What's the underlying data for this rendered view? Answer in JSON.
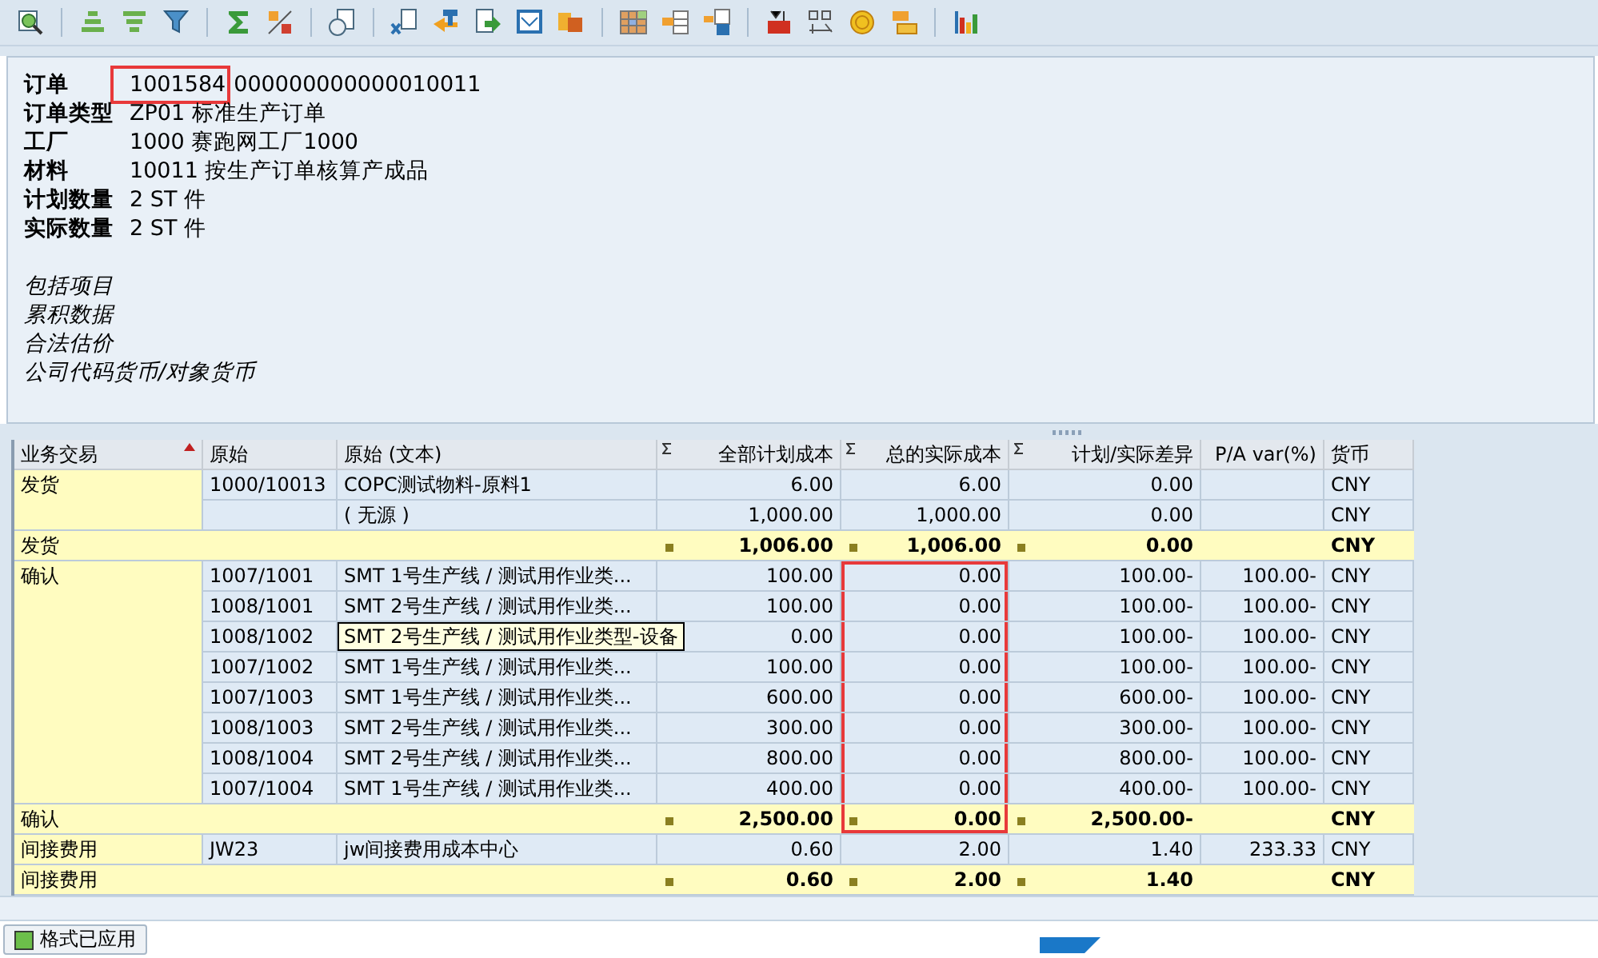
{
  "header": {
    "fields": [
      {
        "label": "订单",
        "highlight": "1001584",
        "value": "000000000000010011"
      },
      {
        "label": "订单类型",
        "value": "ZP01 标准生产订单"
      },
      {
        "label": "工厂",
        "value": "1000 赛跑网工厂1000"
      },
      {
        "label": "材料",
        "value": "10011 按生产订单核算产成品"
      },
      {
        "label": "计划数量",
        "value": "2 ST 件"
      },
      {
        "label": "实际数量",
        "value": "2 ST 件"
      }
    ],
    "notes": [
      "包括项目",
      "累积数据",
      "合法估价",
      "公司代码货币/对象货币"
    ]
  },
  "table": {
    "columns": [
      {
        "label": "业务交易",
        "sorted": true,
        "sum": false
      },
      {
        "label": "原始",
        "sorted": false,
        "sum": false
      },
      {
        "label": "原始 (文本)",
        "sorted": false,
        "sum": false
      },
      {
        "label": "全部计划成本",
        "sorted": false,
        "sum": true
      },
      {
        "label": "总的实际成本",
        "sorted": false,
        "sum": true
      },
      {
        "label": "计划/实际差异",
        "sorted": false,
        "sum": true
      },
      {
        "label": "P/A var(%)",
        "sorted": false,
        "sum": false
      },
      {
        "label": "货币",
        "sorted": false,
        "sum": false
      }
    ],
    "groups": [
      {
        "label": "发货",
        "items": [
          {
            "origin": "1000/10013",
            "text": "COPC测试物料-原料1",
            "plan": "6.00",
            "actual": "6.00",
            "diff": "0.00",
            "currency": "CNY",
            "marked": false
          },
          {
            "text": "( 无源 )",
            "plan": "1,000.00",
            "actual": "1,000.00",
            "diff": "0.00",
            "currency": "CNY",
            "marked": false
          }
        ],
        "total": {
          "label": "发货",
          "plan": "1,006.00",
          "actual": "1,006.00",
          "diff": "0.00",
          "currency": "CNY",
          "marked": false
        }
      },
      {
        "label": "确认",
        "items": [
          {
            "origin": "1007/1001",
            "text": "SMT 1号生产线 / 测试用作业类...",
            "plan": "100.00",
            "actual": "0.00",
            "diff": "100.00-",
            "pct": "100.00-",
            "currency": "CNY",
            "marked": true
          },
          {
            "origin": "1008/1001",
            "text": "SMT 2号生产线 / 测试用作业类...",
            "plan": "100.00",
            "actual": "0.00",
            "diff": "100.00-",
            "pct": "100.00-",
            "currency": "CNY",
            "marked": true
          },
          {
            "origin": "1008/1002",
            "tooltip": "SMT 2号生产线 / 测试用作业类型-设备",
            "plan": "0.00",
            "actual": "0.00",
            "diff": "100.00-",
            "pct": "100.00-",
            "currency": "CNY",
            "marked": true
          },
          {
            "origin": "1007/1002",
            "text": "SMT 1号生产线 / 测试用作业类...",
            "plan": "100.00",
            "actual": "0.00",
            "diff": "100.00-",
            "pct": "100.00-",
            "currency": "CNY",
            "marked": true
          },
          {
            "origin": "1007/1003",
            "text": "SMT 1号生产线 / 测试用作业类...",
            "plan": "600.00",
            "actual": "0.00",
            "diff": "600.00-",
            "pct": "100.00-",
            "currency": "CNY",
            "marked": true
          },
          {
            "origin": "1008/1003",
            "text": "SMT 2号生产线 / 测试用作业类...",
            "plan": "300.00",
            "actual": "0.00",
            "diff": "300.00-",
            "pct": "100.00-",
            "currency": "CNY",
            "marked": true
          },
          {
            "origin": "1008/1004",
            "text": "SMT 2号生产线 / 测试用作业类...",
            "plan": "800.00",
            "actual": "0.00",
            "diff": "800.00-",
            "pct": "100.00-",
            "currency": "CNY",
            "marked": true
          },
          {
            "origin": "1007/1004",
            "text": "SMT 1号生产线 / 测试用作业类...",
            "plan": "400.00",
            "actual": "0.00",
            "diff": "400.00-",
            "pct": "100.00-",
            "currency": "CNY",
            "marked": true
          }
        ],
        "total": {
          "label": "确认",
          "plan": "2,500.00",
          "actual": "0.00",
          "diff": "2,500.00-",
          "currency": "CNY",
          "marked": true
        }
      },
      {
        "label": "间接费用",
        "items": [
          {
            "origin": "JW23",
            "text": "jw间接费用成本中心",
            "plan": "0.60",
            "actual": "2.00",
            "diff": "1.40",
            "pct": "233.33",
            "currency": "CNY",
            "marked": false
          }
        ],
        "total": {
          "label": "间接费用",
          "plan": "0.60",
          "actual": "2.00",
          "diff": "1.40",
          "currency": "CNY",
          "marked": false
        }
      }
    ]
  },
  "bottom_button": {
    "label": "格式已应用"
  }
}
